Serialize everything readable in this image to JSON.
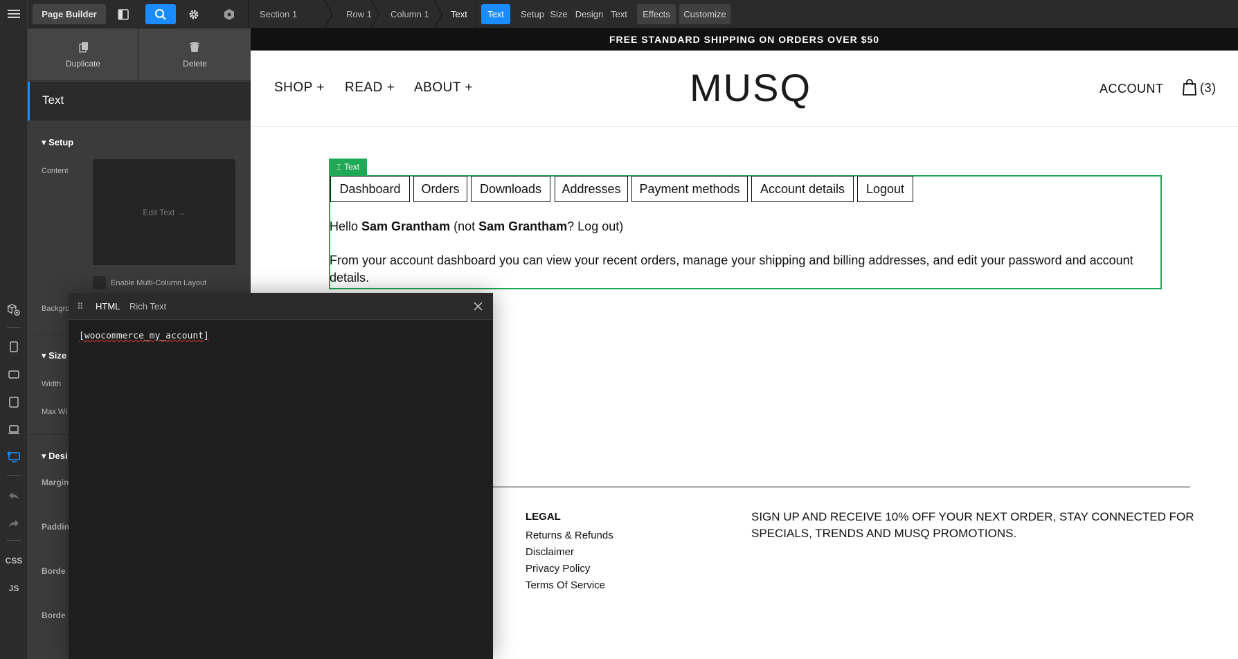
{
  "builder": {
    "title": "Page Builder",
    "breadcrumbs": [
      "Section 1",
      "Row 1",
      "Column 1",
      "Text"
    ],
    "active_tag": "Text",
    "tabs": [
      "Setup",
      "Size",
      "Design",
      "Text"
    ],
    "extra_tabs": [
      "Effects",
      "Customize"
    ],
    "rail_labels": {
      "css": "CSS",
      "js": "JS"
    },
    "accent": "#1a8cff"
  },
  "panel": {
    "duplicate": "Duplicate",
    "delete": "Delete",
    "element_title": "Text",
    "setup_title": "Setup",
    "content_label": "Content",
    "edit_text": "Edit Text →",
    "multi_column": "Enable Multi-Column Layout",
    "background_label": "Backgro",
    "size_title": "Size",
    "width_label": "Width",
    "max_width_label": "Max Wi",
    "design_title": "Desi",
    "margin_label": "Margin",
    "padding_label": "Paddin",
    "border1_label": "Borde",
    "border2_label": "Borde"
  },
  "modal": {
    "tab_html": "HTML",
    "tab_rich": "Rich Text",
    "code": "[woocommerce_my_account]"
  },
  "site": {
    "shipping_banner": "FREE STANDARD SHIPPING ON ORDERS OVER $50",
    "nav": [
      "SHOP +",
      "READ +",
      "ABOUT +"
    ],
    "logo": "MUSQ",
    "account": "ACCOUNT",
    "cart_count": "(3)",
    "element_badge": "Text",
    "account_tabs": [
      "Dashboard",
      "Orders",
      "Downloads",
      "Addresses",
      "Payment methods",
      "Account details",
      "Logout"
    ],
    "hello_prefix": "Hello ",
    "user_name": "Sam Grantham",
    "hello_mid": " (not ",
    "hello_suffix": "? Log out)",
    "dashboard_text_1": "From your account dashboard you can view your recent orders, manage your shipping and billing addresses, and edit your password and account",
    "dashboard_text_2": "details.",
    "badge_color": "#1fa855"
  },
  "footer": {
    "legal_title": "LEGAL",
    "legal_links": [
      "Returns & Refunds",
      "Disclaimer",
      "Privacy Policy",
      "Terms Of Service"
    ],
    "signup_line1": "SIGN UP AND RECEIVE 10% OFF YOUR NEXT ORDER, STAY CONNECTED FOR",
    "signup_line2": "SPECIALS, TRENDS AND MUSQ PROMOTIONS."
  }
}
